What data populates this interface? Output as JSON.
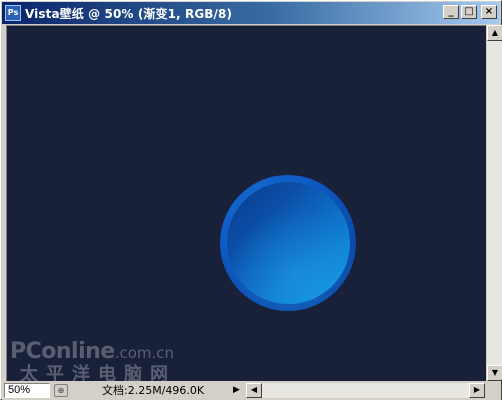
{
  "window": {
    "title": "Vista壁纸 @ 50% (渐变1, RGB/8)",
    "app_icon_label": "Ps",
    "controls": {
      "minimize": "_",
      "restore": "□",
      "close": "×"
    }
  },
  "canvas": {
    "background_color": "#19203a",
    "orb_colors": [
      "#0a3a88",
      "#14a2e4"
    ]
  },
  "watermark": {
    "brand": "PConline",
    "domain": ".com.cn",
    "chinese": "太平洋电脑网"
  },
  "status": {
    "zoom": "50%",
    "doc_info": "文档:2.25M/496.0K",
    "menu_arrow": "▶"
  },
  "scrollbars": {
    "up": "▲",
    "down": "▼",
    "left": "◀",
    "right": "▶"
  }
}
